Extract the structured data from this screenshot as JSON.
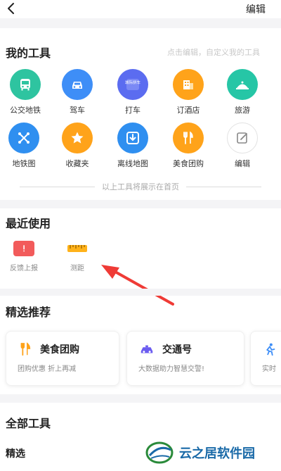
{
  "header": {
    "back_icon": "chevron-left-icon",
    "edit_label": "编辑"
  },
  "my_tools": {
    "title": "我的工具",
    "hint": "点击编辑，自定义我的工具",
    "items": [
      {
        "label": "公交地铁",
        "icon": "bus-icon",
        "color": "#2ec4a0"
      },
      {
        "label": "驾车",
        "icon": "car-icon",
        "color": "#3e8ef7"
      },
      {
        "label": "打车",
        "icon": "taxi-icon",
        "color": "#5b6cf0",
        "icon_text": "城际拼车"
      },
      {
        "label": "订酒店",
        "icon": "hotel-icon",
        "color": "#ffa31a"
      },
      {
        "label": "旅游",
        "icon": "travel-icon",
        "color": "#26c6a6"
      },
      {
        "label": "地铁图",
        "icon": "subway-map-icon",
        "color": "#2f8ff0"
      },
      {
        "label": "收藏夹",
        "icon": "star-icon",
        "color": "#ffa31a"
      },
      {
        "label": "离线地图",
        "icon": "download-icon",
        "color": "#2f8ff0"
      },
      {
        "label": "美食团购",
        "icon": "food-icon",
        "color": "#ffa31a"
      },
      {
        "label": "编辑",
        "icon": "edit-icon",
        "color": "#ffffff"
      }
    ]
  },
  "divider_text": "以上工具将展示在首页",
  "recent": {
    "title": "最近使用",
    "items": [
      {
        "label": "反馈上报",
        "icon": "feedback-icon",
        "color": "#f25b5b"
      },
      {
        "label": "测距",
        "icon": "ruler-icon",
        "color": "#ffb21a"
      }
    ]
  },
  "featured": {
    "title": "精选推荐",
    "cards": [
      {
        "title": "美食团购",
        "subtitle": "团购优惠 折上再减",
        "icon": "food-icon",
        "color": "#ffa31a"
      },
      {
        "title": "交通号",
        "subtitle": "大数据助力智慧交警!",
        "icon": "police-car-icon",
        "color": "#6b5cf0"
      },
      {
        "title": "",
        "subtitle": "实时",
        "icon": "runner-icon",
        "color": "#3e8ef7"
      }
    ]
  },
  "all_tools": {
    "title": "全部工具",
    "subtitle": "精选"
  },
  "watermark": {
    "text": "云之居软件园"
  }
}
